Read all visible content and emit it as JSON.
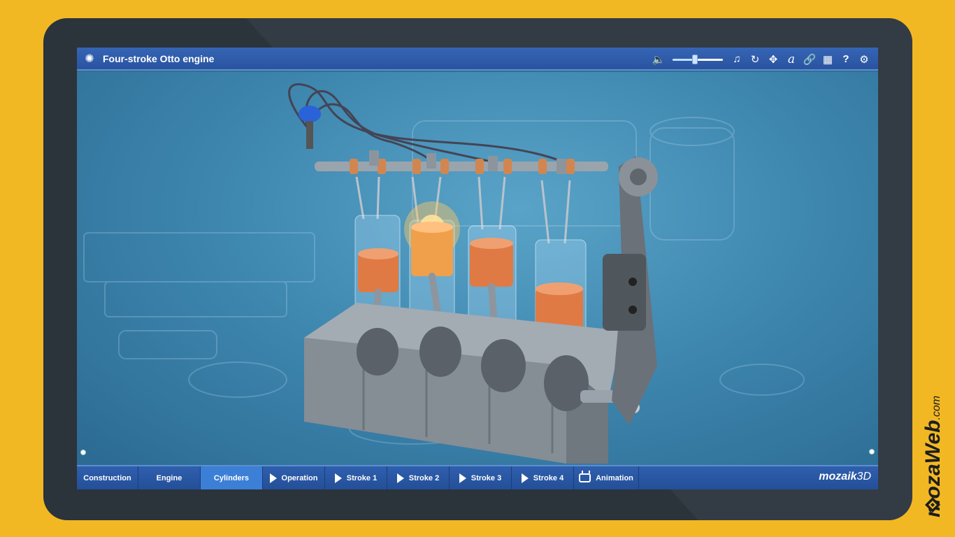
{
  "app": {
    "title": "Four-stroke Otto engine"
  },
  "toolbar": {
    "volume_level": 0.45,
    "icons": [
      "menu-icon",
      "speaker-icon",
      "volume-slider",
      "music-note-icon",
      "rotate-icon",
      "move-icon",
      "font-icon",
      "link-icon",
      "layout-icon",
      "help-icon",
      "settings-icon"
    ]
  },
  "tabs": [
    {
      "label": "Construction",
      "icon": "",
      "active": false
    },
    {
      "label": "Engine",
      "icon": "",
      "active": false
    },
    {
      "label": "Cylinders",
      "icon": "",
      "active": true
    },
    {
      "label": "Operation",
      "icon": "play-icon",
      "active": false
    },
    {
      "label": "Stroke 1",
      "icon": "play-icon",
      "active": false
    },
    {
      "label": "Stroke 2",
      "icon": "play-icon",
      "active": false
    },
    {
      "label": "Stroke 3",
      "icon": "play-icon",
      "active": false
    },
    {
      "label": "Stroke 4",
      "icon": "play-icon",
      "active": false
    },
    {
      "label": "Animation",
      "icon": "tv-icon",
      "active": false
    }
  ],
  "brand": {
    "product_bold": "mozaik",
    "product_light": "3D",
    "site_bold": "mozaWeb",
    "site_domain": ".com"
  },
  "colors": {
    "frame_background": "#f2b824",
    "titlebar": "#2a53a0",
    "active_tab": "#3c7fd6",
    "scene_background": "#3f88b0",
    "piston": "#e07a45",
    "ignition": "#ffb24a"
  }
}
